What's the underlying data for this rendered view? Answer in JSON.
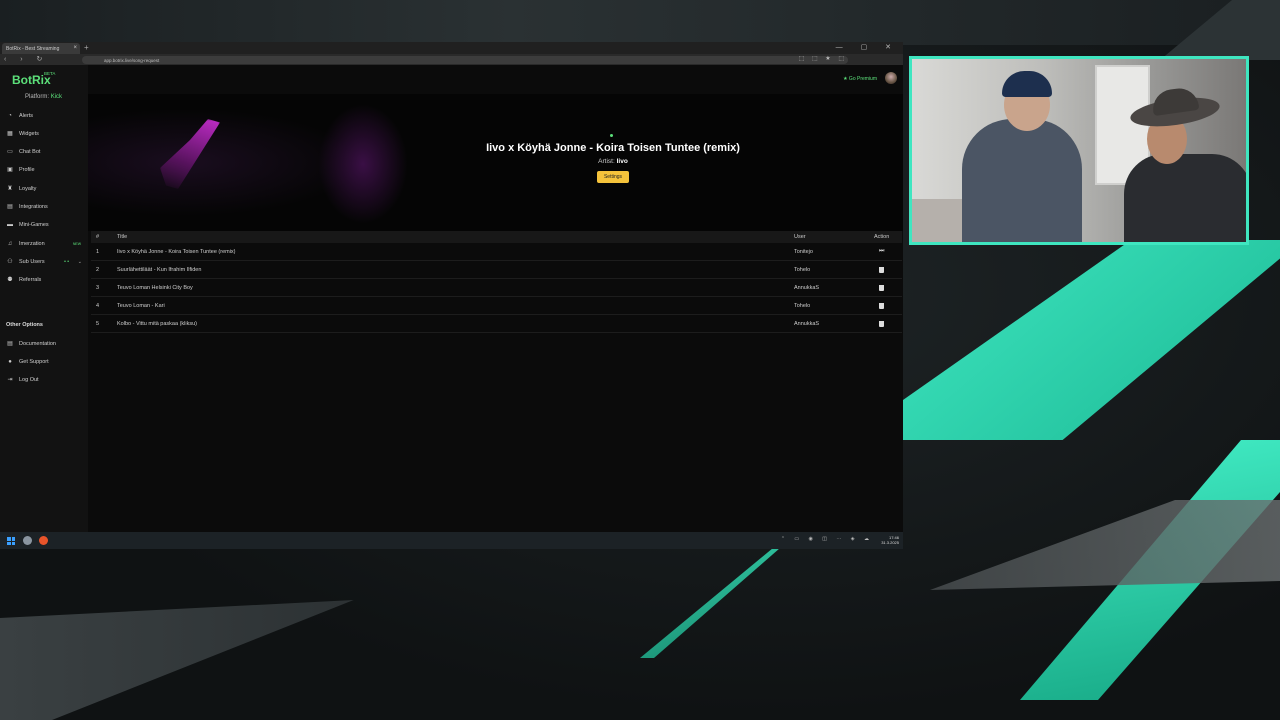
{
  "browser": {
    "tab_title": "BotRix - Best Streaming",
    "tab_close": "×",
    "new_tab": "+",
    "window_controls": "— ▢ ✕",
    "nav_controls": "‹ › ↻",
    "url": "app.botrix.live/song-request",
    "extensions": "⬚ ⬚ ★ ⬚"
  },
  "app": {
    "logo": "BotRix",
    "beta": "BETA",
    "platform_label": "Platform:",
    "platform_value": "Kick",
    "premium": "★ Go Premium"
  },
  "sidebar": {
    "items": [
      {
        "label": "Alerts",
        "icon": "bell-icon"
      },
      {
        "label": "Widgets",
        "icon": "grid-icon"
      },
      {
        "label": "Chat Bot",
        "icon": "chat-icon"
      },
      {
        "label": "Profile",
        "icon": "profile-icon"
      },
      {
        "label": "Loyalty",
        "icon": "trophy-icon"
      },
      {
        "label": "Integrations",
        "icon": "plug-icon"
      },
      {
        "label": "Mini-Games",
        "icon": "gamepad-icon"
      },
      {
        "label": "Imerzation",
        "icon": "music-icon",
        "badge": "NEW"
      },
      {
        "label": "Sub Users",
        "icon": "users-icon",
        "chevron": "⌄",
        "dots": "• •"
      },
      {
        "label": "Referrals",
        "icon": "referral-icon"
      }
    ],
    "other_heading": "Other Options",
    "other_items": [
      {
        "label": "Documentation",
        "icon": "doc-icon"
      },
      {
        "label": "Get Support",
        "icon": "support-icon"
      },
      {
        "label": "Log Out",
        "icon": "logout-icon"
      }
    ]
  },
  "player": {
    "title": "Iivo x Köyhä Jonne - Koira Toisen Tuntee (remix)",
    "artist_label": "Artist:",
    "artist": "Iivo",
    "settings_button": "Settings"
  },
  "queue": {
    "headers": {
      "num": "#",
      "title": "Title",
      "user": "User",
      "action": "Action"
    },
    "rows": [
      {
        "num": "1",
        "title": "Iivo x Köyhä Jonne - Koira Toisen Tuntee (remix)",
        "user": "Tonitejo",
        "action": "skip"
      },
      {
        "num": "2",
        "title": "Suurlähettiläät - Kun Ifrahim Ilfiden",
        "user": "Tohelo",
        "action": "delete"
      },
      {
        "num": "3",
        "title": "Teuvo Loman Helsinki City Boy",
        "user": "AnnukkaS",
        "action": "delete"
      },
      {
        "num": "4",
        "title": "Teuvo Loman - Kari",
        "user": "Tohelo",
        "action": "delete"
      },
      {
        "num": "5",
        "title": "Kolbo - Vittu mitä paskaa (kliksu)",
        "user": "AnnukkaS",
        "action": "delete"
      }
    ],
    "skip_glyph": "⏭"
  },
  "taskbar": {
    "tray": "⌃ ▭ ◉ ◫ ⋯ ◈ ☁",
    "time": "17:46",
    "date": "31.3.2025"
  },
  "colors": {
    "accent_green": "#5ce07a",
    "settings_yellow": "#f5c33b",
    "teal_frame": "#3fe6c0"
  }
}
